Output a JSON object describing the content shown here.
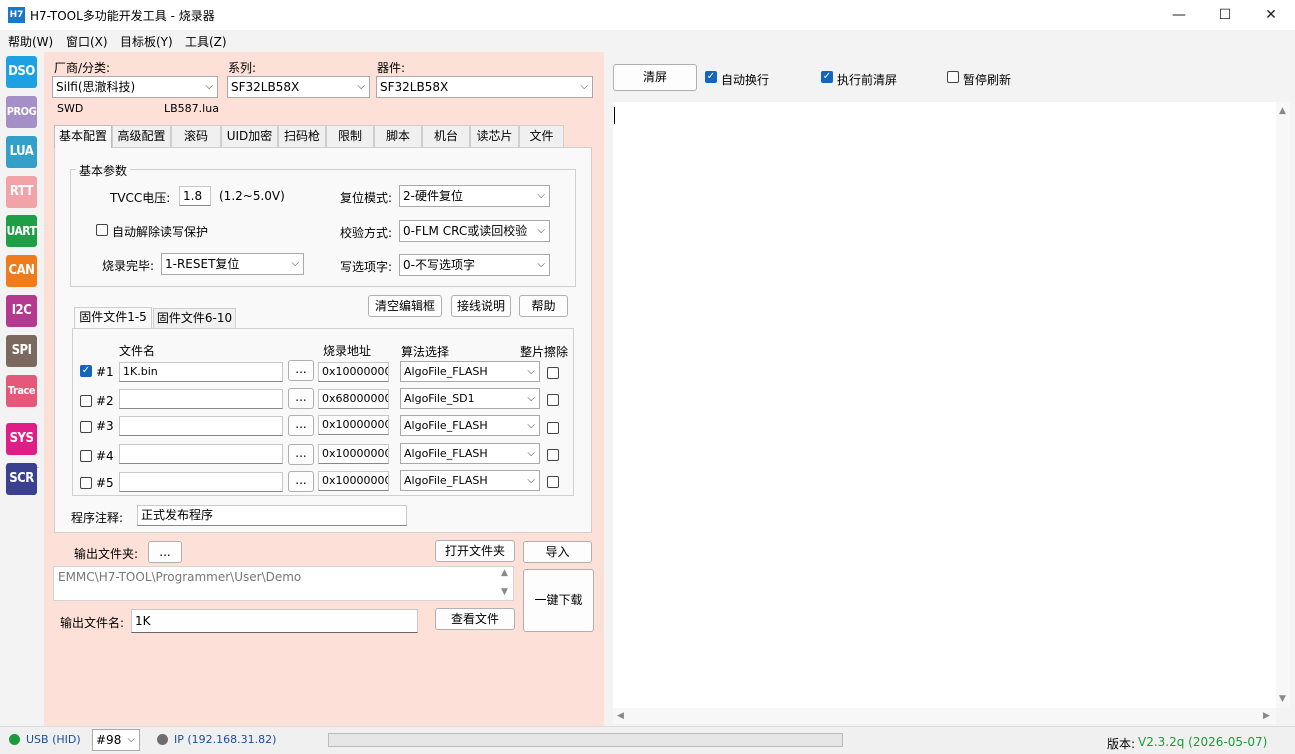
{
  "window": {
    "icon_text": "H7",
    "title": "H7-TOOL多功能开发工具 - 烧录器",
    "minimize": "—",
    "maximize": "☐",
    "close": "✕"
  },
  "menu": [
    "帮助(W)",
    "窗口(X)",
    "目标板(Y)",
    "工具(Z)"
  ],
  "toolbar": [
    {
      "label": "DSO",
      "color": "#1da1e2"
    },
    {
      "label": "PROG",
      "color": "#a48fc6"
    },
    {
      "label": "LUA",
      "color": "#32a0c8"
    },
    {
      "label": "RTT",
      "color": "#f2a3a8"
    },
    {
      "label": "UART",
      "color": "#1e9e46"
    },
    {
      "label": "CAN",
      "color": "#ef7b1a"
    },
    {
      "label": "I2C",
      "color": "#b53a8f"
    },
    {
      "label": "SPI",
      "color": "#7b6960"
    },
    {
      "label": "Trace",
      "color": "#e5587a"
    },
    {
      "label": "SYS",
      "color": "#e01e88"
    },
    {
      "label": "SCR",
      "color": "#3b3f8f"
    }
  ],
  "selector": {
    "vendor_label": "厂商/分类:",
    "vendor_value": "Silfi(思澈科技)",
    "series_label": "系列:",
    "series_value": "SF32LB58X",
    "device_label": "器件:",
    "device_value": "SF32LB58X",
    "interface": "SWD",
    "lua_file": "LB587.lua"
  },
  "tabs": [
    "基本配置",
    "高级配置",
    "滚码",
    "UID加密",
    "扫码枪",
    "限制",
    "脚本",
    "机台",
    "读芯片",
    "文件"
  ],
  "basic": {
    "group_title": "基本参数",
    "tvcc_label": "TVCC电压:",
    "tvcc_value": "1.8",
    "tvcc_range": "(1.2~5.0V)",
    "auto_unlock_label": "自动解除读写保护",
    "finish_label": "烧录完毕:",
    "finish_value": "1-RESET复位",
    "reset_mode_label": "复位模式:",
    "reset_mode_value": "2-硬件复位",
    "verify_label": "校验方式:",
    "verify_value": "0-FLM CRC或读回校验",
    "option_label": "写选项字:",
    "option_value": "0-不写选项字"
  },
  "buttons": {
    "clear_editor": "清空编辑框",
    "wiring": "接线说明",
    "help": "帮助",
    "browse": "...",
    "open_folder": "打开文件夹",
    "import": "导入",
    "view_file": "查看文件",
    "one_key_download": "一键下载",
    "clear_screen": "清屏"
  },
  "firmware_tabs": [
    "固件文件1-5",
    "固件文件6-10"
  ],
  "firmware_headers": {
    "file": "文件名",
    "addr": "烧录地址",
    "algo": "算法选择",
    "erase": "整片擦除"
  },
  "firmware_rows": [
    {
      "id": "#1",
      "checked": true,
      "file": "1K.bin",
      "addr": "0x10000000",
      "algo": "AlgoFile_FLASH"
    },
    {
      "id": "#2",
      "checked": false,
      "file": "",
      "addr": "0x68000000",
      "algo": "AlgoFile_SD1"
    },
    {
      "id": "#3",
      "checked": false,
      "file": "",
      "addr": "0x10000000",
      "algo": "AlgoFile_FLASH"
    },
    {
      "id": "#4",
      "checked": false,
      "file": "",
      "addr": "0x10000000",
      "algo": "AlgoFile_FLASH"
    },
    {
      "id": "#5",
      "checked": false,
      "file": "",
      "addr": "0x10000000",
      "algo": "AlgoFile_FLASH"
    }
  ],
  "program_note": {
    "label": "程序注释:",
    "value": "正式发布程序"
  },
  "output": {
    "folder_label": "输出文件夹:",
    "folder_path": "EMMC\\H7-TOOL\\Programmer\\User\\Demo",
    "name_label": "输出文件名:",
    "name_value": "1K"
  },
  "right": {
    "auto_wrap": "自动换行",
    "clear_before_run": "执行前清屏",
    "pause_refresh": "暂停刷新"
  },
  "status": {
    "usb": "USB (HID)",
    "device_no": "#98",
    "ip": "IP (192.168.31.82)",
    "version_label": "版本:",
    "version_value": "V2.3.2q (2026-05-07)",
    "usb_color": "#1a9c3a",
    "ip_color": "#6e6e6e"
  }
}
